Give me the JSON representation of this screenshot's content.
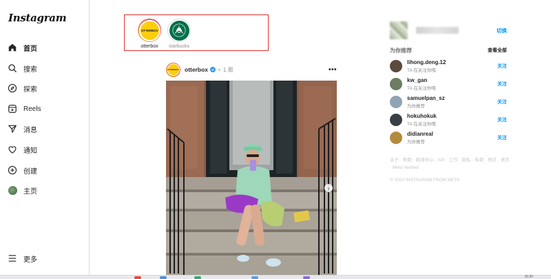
{
  "app": {
    "logo": "Instagram"
  },
  "sidebar": {
    "items": [
      {
        "label": "首页",
        "icon": "home-icon",
        "active": true
      },
      {
        "label": "搜索",
        "icon": "search-icon"
      },
      {
        "label": "探索",
        "icon": "compass-icon"
      },
      {
        "label": "Reels",
        "icon": "reels-icon"
      },
      {
        "label": "消息",
        "icon": "send-icon"
      },
      {
        "label": "通知",
        "icon": "heart-icon"
      },
      {
        "label": "创建",
        "icon": "plus-square-icon"
      },
      {
        "label": "主页",
        "icon": "avatar"
      }
    ],
    "more": {
      "label": "更多",
      "icon": "menu-icon"
    }
  },
  "stories": [
    {
      "name": "otterbox",
      "logo_text": "OTTERBOX",
      "seen": false
    },
    {
      "name": "starbucks",
      "seen": true
    }
  ],
  "post": {
    "username": "otterbox",
    "separator": "•",
    "time": "1 周",
    "more": "•••",
    "avatar_text": "OTTERBOX",
    "carousel_next": "›"
  },
  "right_panel": {
    "switch_label": "切换",
    "suggestions_title": "为你推荐",
    "see_all": "查看全部",
    "suggestions": [
      {
        "name": "lihong.deng.12",
        "sub": "TA 在关注你哦",
        "follow": "关注",
        "color": "#5b4a3e"
      },
      {
        "name": "kw_gan",
        "sub": "TA 在关注你哦",
        "follow": "关注",
        "color": "#6e7c63"
      },
      {
        "name": "samuelpan_sz",
        "sub": "为你推荐",
        "follow": "关注",
        "color": "#8fa3b5"
      },
      {
        "name": "hokuhokuk",
        "sub": "TA 在关注你哦",
        "follow": "关注",
        "color": "#3a3f47"
      },
      {
        "name": "didianreal",
        "sub": "为你推荐",
        "follow": "关注",
        "color": "#b48a3c"
      }
    ],
    "footer_links": "关于 · 帮助 · 新闻中心 · API · 工作 · 隐私 · 条款 · 地点 · 语言 · Meta Verified",
    "copyright": "© 2023 INSTAGRAM FROM META"
  },
  "taskbar": {
    "clock": "15:20"
  },
  "colors": {
    "accent": "#0095f6",
    "highlight_border": "#e0322f",
    "verified": "#3897f0"
  }
}
